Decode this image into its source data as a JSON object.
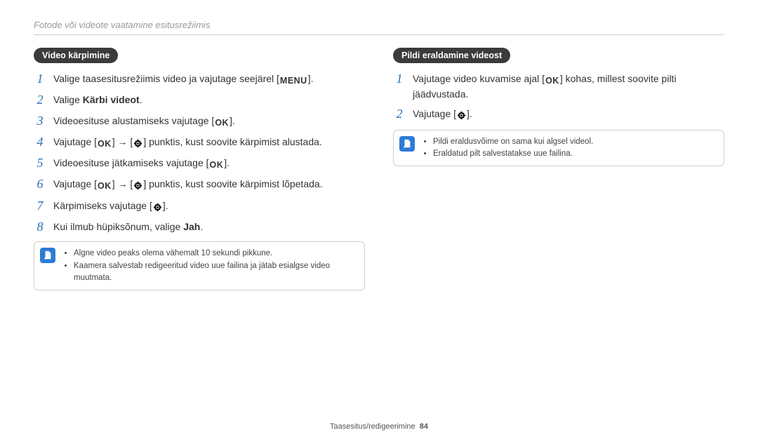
{
  "chapter_title": "Fotode või videote vaatamine esitusrežiimis",
  "left": {
    "heading": "Video kärpimine",
    "steps": [
      {
        "n": "1",
        "pre": "Valige taasesitusrežiimis video ja vajutage seejärel [",
        "icon": "MENU",
        "post": "]."
      },
      {
        "n": "2",
        "pre": "Valige ",
        "bold": "Kärbi videot",
        "post": "."
      },
      {
        "n": "3",
        "pre": "Videoesituse alustamiseks vajutage [",
        "icon": "OK",
        "post": "]."
      },
      {
        "n": "4",
        "pre": "Vajutage [",
        "icon": "OK",
        "mid1": "] → [",
        "icon2": "flower",
        "mid2": "] punktis, kust soovite kärpimist alustada."
      },
      {
        "n": "5",
        "pre": "Videoesituse jätkamiseks vajutage [",
        "icon": "OK",
        "post": "]."
      },
      {
        "n": "6",
        "pre": "Vajutage [",
        "icon": "OK",
        "mid1": "] → [",
        "icon2": "flower",
        "mid2": "] punktis, kust soovite kärpimist lõpetada."
      },
      {
        "n": "7",
        "pre": "Kärpimiseks vajutage [",
        "icon": "flower",
        "post": "]."
      },
      {
        "n": "8",
        "pre": "Kui ilmub hüpiksõnum, valige ",
        "bold": "Jah",
        "post": "."
      }
    ],
    "notes": [
      "Algne video peaks olema vähemalt 10 sekundi pikkune.",
      "Kaamera salvestab redigeeritud video uue failina ja jätab esialgse video muutmata."
    ]
  },
  "right": {
    "heading": "Pildi eraldamine videost",
    "steps": [
      {
        "n": "1",
        "pre": "Vajutage video kuvamise ajal [",
        "icon": "OK",
        "post": "] kohas, millest soovite pilti jäädvustada."
      },
      {
        "n": "2",
        "pre": "Vajutage [",
        "icon": "flower",
        "post": "]."
      }
    ],
    "notes": [
      "Pildi eraldusvõime on sama kui algsel videol.",
      "Eraldatud pilt salvestatakse uue failina."
    ]
  },
  "footer": {
    "section": "Taasesitus/redigeerimine",
    "page": "84"
  }
}
